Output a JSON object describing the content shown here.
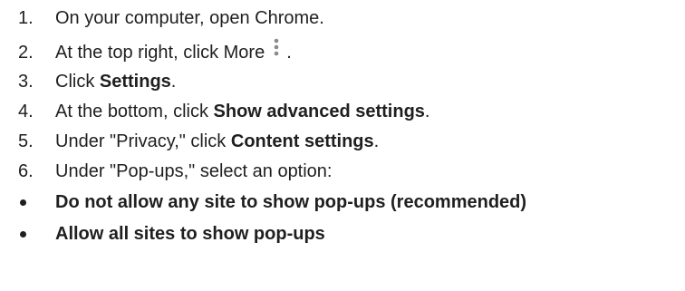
{
  "steps": [
    {
      "number": "1.",
      "text": "On your computer, open Chrome."
    },
    {
      "number": "2.",
      "before": "At the top right, click More",
      "after": "."
    },
    {
      "number": "3.",
      "before": "Click ",
      "bold": "Settings",
      "after": "."
    },
    {
      "number": "4.",
      "before": "At the bottom, click ",
      "bold": "Show advanced settings",
      "after": "."
    },
    {
      "number": "5.",
      "before": "Under \"Privacy,\" click ",
      "bold": "Content settings",
      "after": "."
    },
    {
      "number": "6.",
      "text": "Under \"Pop-ups,\" select an option:"
    }
  ],
  "options": [
    {
      "bold": "Do not allow any site to show pop-ups (recommended)"
    },
    {
      "bold": "Allow all sites to show pop-ups"
    }
  ],
  "icons": {
    "more": "vertical-three-dots-icon",
    "bullet": "filled-circle-bullet"
  },
  "colors": {
    "text": "#1f1f1f",
    "icon": "#8a8a8a"
  }
}
